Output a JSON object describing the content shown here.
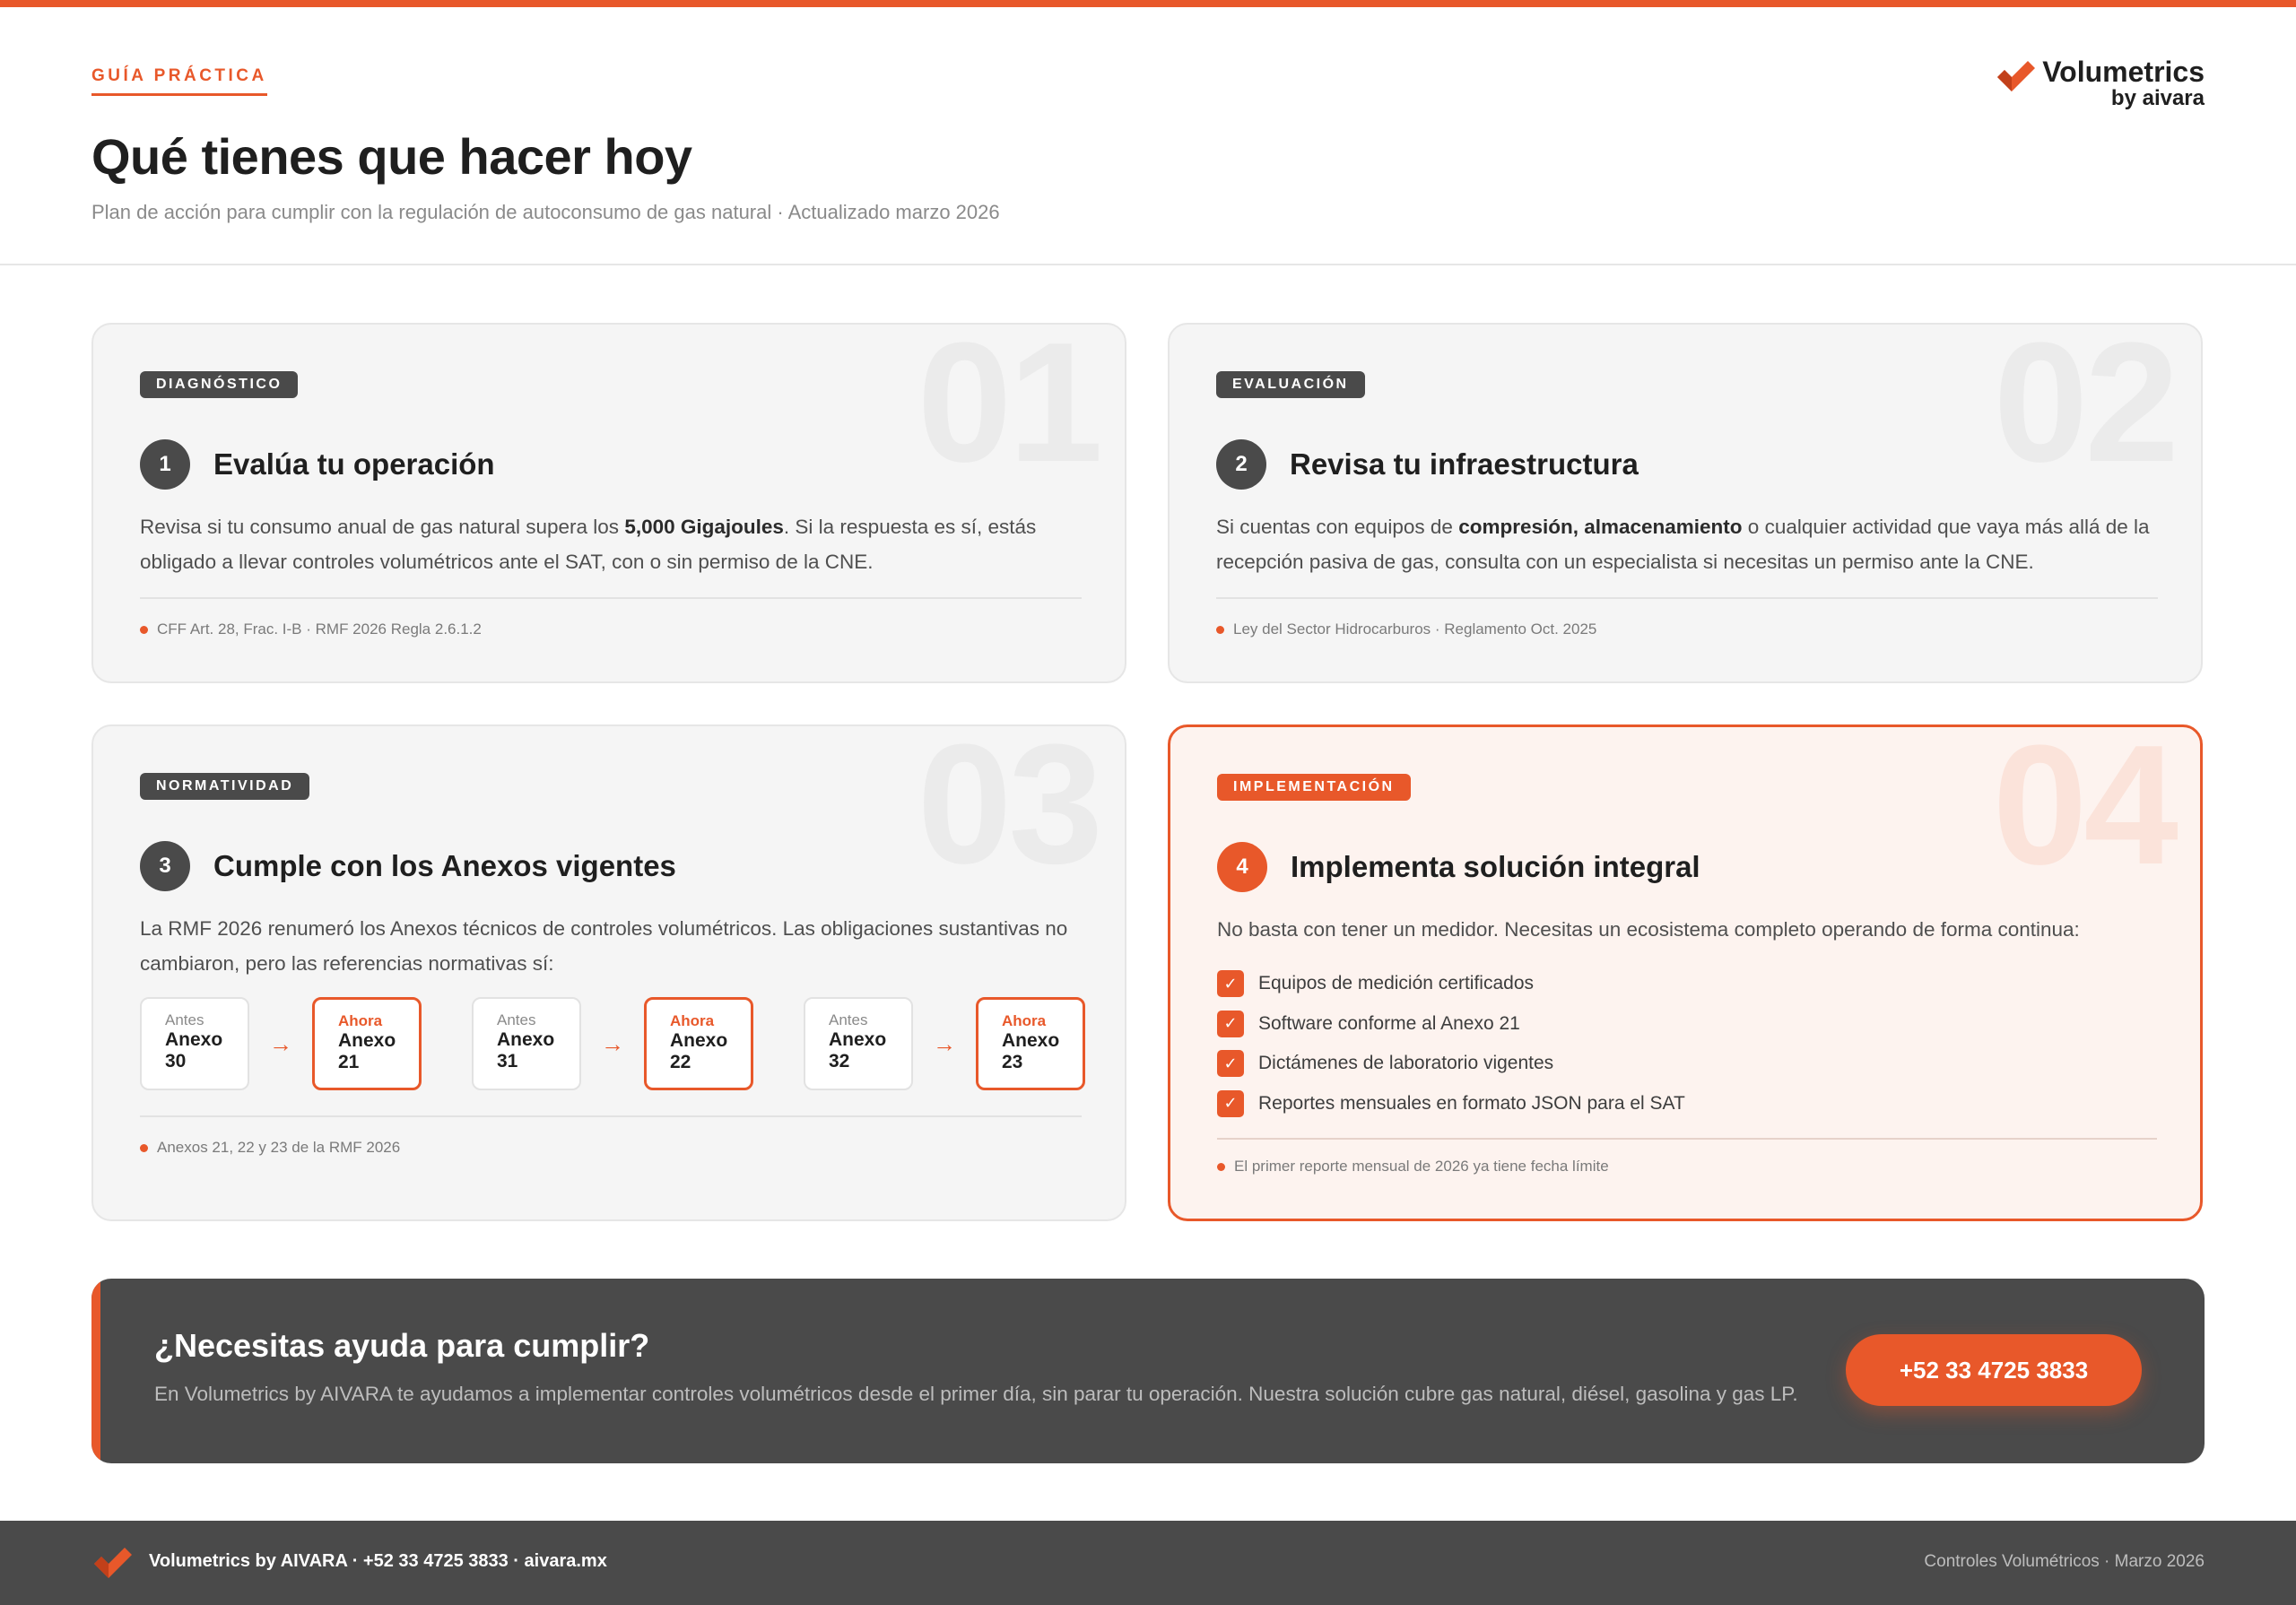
{
  "colors": {
    "accent": "#e8582a",
    "dark": "#4a4a4a",
    "card_bg": "#f5f5f5",
    "highlight_bg": "#fdf3ef"
  },
  "header": {
    "eyebrow": "GUÍA PRÁCTICA",
    "title": "Qué tienes que hacer hoy",
    "subtitle": "Plan de acción para cumplir con la regulación de autoconsumo de gas natural · Actualizado marzo 2026",
    "brand_name": "Volumetrics",
    "brand_sub": "by aivara"
  },
  "cards": [
    {
      "number": "01",
      "tag": "DIAGNÓSTICO",
      "step": "1",
      "title": "Evalúa tu operación",
      "body_pre": "Revisa si tu consumo anual de gas natural supera los ",
      "body_bold": "5,000 Gigajoules",
      "body_post": ". Si la respuesta es sí, estás obligado a llevar controles volumétricos ante el SAT, con o sin permiso de la CNE.",
      "footnote": "CFF Art. 28, Frac. I-B · RMF 2026 Regla 2.6.1.2"
    },
    {
      "number": "02",
      "tag": "EVALUACIÓN",
      "step": "2",
      "title": "Revisa tu infraestructura",
      "body_pre": "Si cuentas con equipos de ",
      "body_bold": "compresión, almacenamiento",
      "body_post": " o cualquier actividad que vaya más allá de la recepción pasiva de gas, consulta con un especialista si necesitas un permiso ante la CNE.",
      "footnote": "Ley del Sector Hidrocarburos · Reglamento Oct. 2025"
    },
    {
      "number": "03",
      "tag": "NORMATIVIDAD",
      "step": "3",
      "title": "Cumple con los Anexos vigentes",
      "body": "La RMF 2026 renumeró los Anexos técnicos de controles volumétricos. Las obligaciones sustantivas no cambiaron, pero las referencias normativas sí:",
      "anexos": [
        {
          "before_label": "Antes",
          "before_value": "Anexo 30",
          "after_label": "Ahora",
          "after_value": "Anexo 21"
        },
        {
          "before_label": "Antes",
          "before_value": "Anexo 31",
          "after_label": "Ahora",
          "after_value": "Anexo 22"
        },
        {
          "before_label": "Antes",
          "before_value": "Anexo 32",
          "after_label": "Ahora",
          "after_value": "Anexo 23"
        }
      ],
      "arrow": "→",
      "footnote": "Anexos 21, 22 y 23 de la RMF 2026"
    },
    {
      "number": "04",
      "tag": "IMPLEMENTACIÓN",
      "step": "4",
      "title": "Implementa solución integral",
      "body": "No basta con tener un medidor. Necesitas un ecosistema completo operando de forma continua:",
      "check_glyph": "✓",
      "checklist": [
        "Equipos de medición certificados",
        "Software conforme al Anexo 21",
        "Dictámenes de laboratorio vigentes",
        "Reportes mensuales en formato JSON para el SAT"
      ],
      "footnote": "El primer reporte mensual de 2026 ya tiene fecha límite"
    }
  ],
  "cta": {
    "title": "¿Necesitas ayuda para cumplir?",
    "text": "En Volumetrics by AIVARA te ayudamos a implementar controles volumétricos desde el primer día, sin parar tu operación. Nuestra solución cubre gas natural, diésel, gasolina y gas LP.",
    "button": "+52 33 4725 3833"
  },
  "footer": {
    "left": "Volumetrics by AIVARA · +52 33 4725 3833 · aivara.mx",
    "right": "Controles Volumétricos · Marzo 2026"
  }
}
